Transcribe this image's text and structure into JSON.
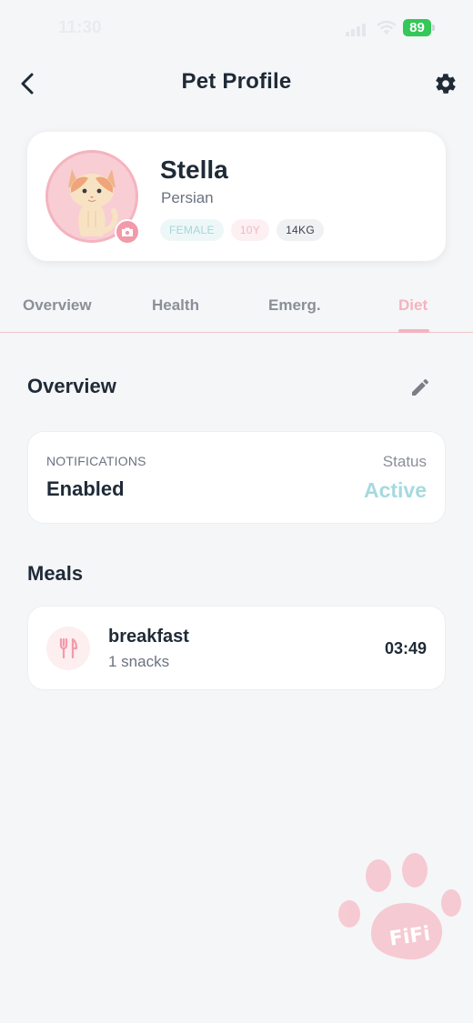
{
  "status_bar": {
    "time": "11:30",
    "battery": "89"
  },
  "header": {
    "title": "Pet Profile",
    "back_icon": "chevron-left-icon",
    "settings_icon": "gear-icon"
  },
  "profile": {
    "name": "Stella",
    "breed": "Persian",
    "tags": {
      "gender": "FEMALE",
      "age": "10Y",
      "weight": "14KG"
    }
  },
  "tabs": [
    {
      "label": "Overview",
      "active": false
    },
    {
      "label": "Health",
      "active": false
    },
    {
      "label": "Emerg.",
      "active": false
    },
    {
      "label": "Diet",
      "active": true
    }
  ],
  "overview": {
    "title": "Overview",
    "notifications_label": "NOTIFICATIONS",
    "notifications_value": "Enabled",
    "status_label": "Status",
    "status_value": "Active"
  },
  "meals": {
    "title": "Meals",
    "items": [
      {
        "name": "breakfast",
        "description": "1 snacks",
        "time": "03:49"
      }
    ]
  },
  "watermark": {
    "text": "FiFi"
  },
  "colors": {
    "accent_pink": "#f5b3bf",
    "active_teal": "#a5dadf",
    "text_dark": "#1f2a37"
  }
}
